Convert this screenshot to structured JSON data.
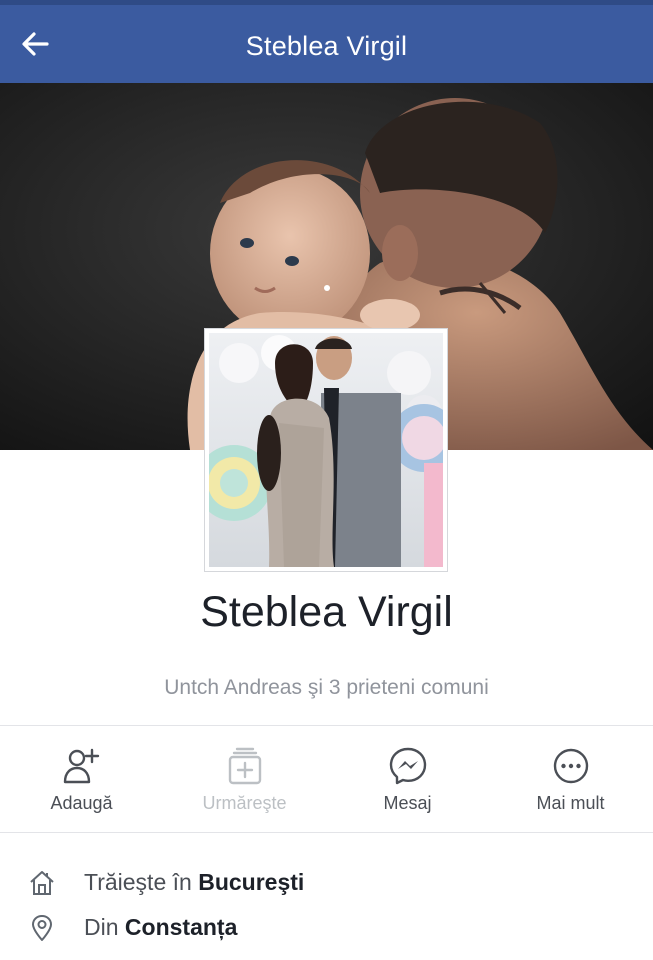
{
  "header": {
    "title": "Steblea Virgil",
    "back_icon": "arrow-left-icon"
  },
  "profile": {
    "name": "Steblea Virgil",
    "mutual_friends": "Untch Andreas şi 3 prieteni comuni"
  },
  "actions": [
    {
      "label": "Adaugă",
      "icon": "add-friend-icon",
      "enabled": true
    },
    {
      "label": "Urmăreşte",
      "icon": "follow-icon",
      "enabled": false
    },
    {
      "label": "Mesaj",
      "icon": "messenger-icon",
      "enabled": true
    },
    {
      "label": "Mai mult",
      "icon": "more-icon",
      "enabled": true
    }
  ],
  "info": {
    "lives_prefix": "Trăieşte în",
    "lives_city": "Bucureşti",
    "from_prefix": "Din",
    "from_city": "Constanța"
  },
  "colors": {
    "header_bg": "#3b5ba0",
    "text_primary": "#1d2129",
    "text_secondary": "#90949c"
  }
}
